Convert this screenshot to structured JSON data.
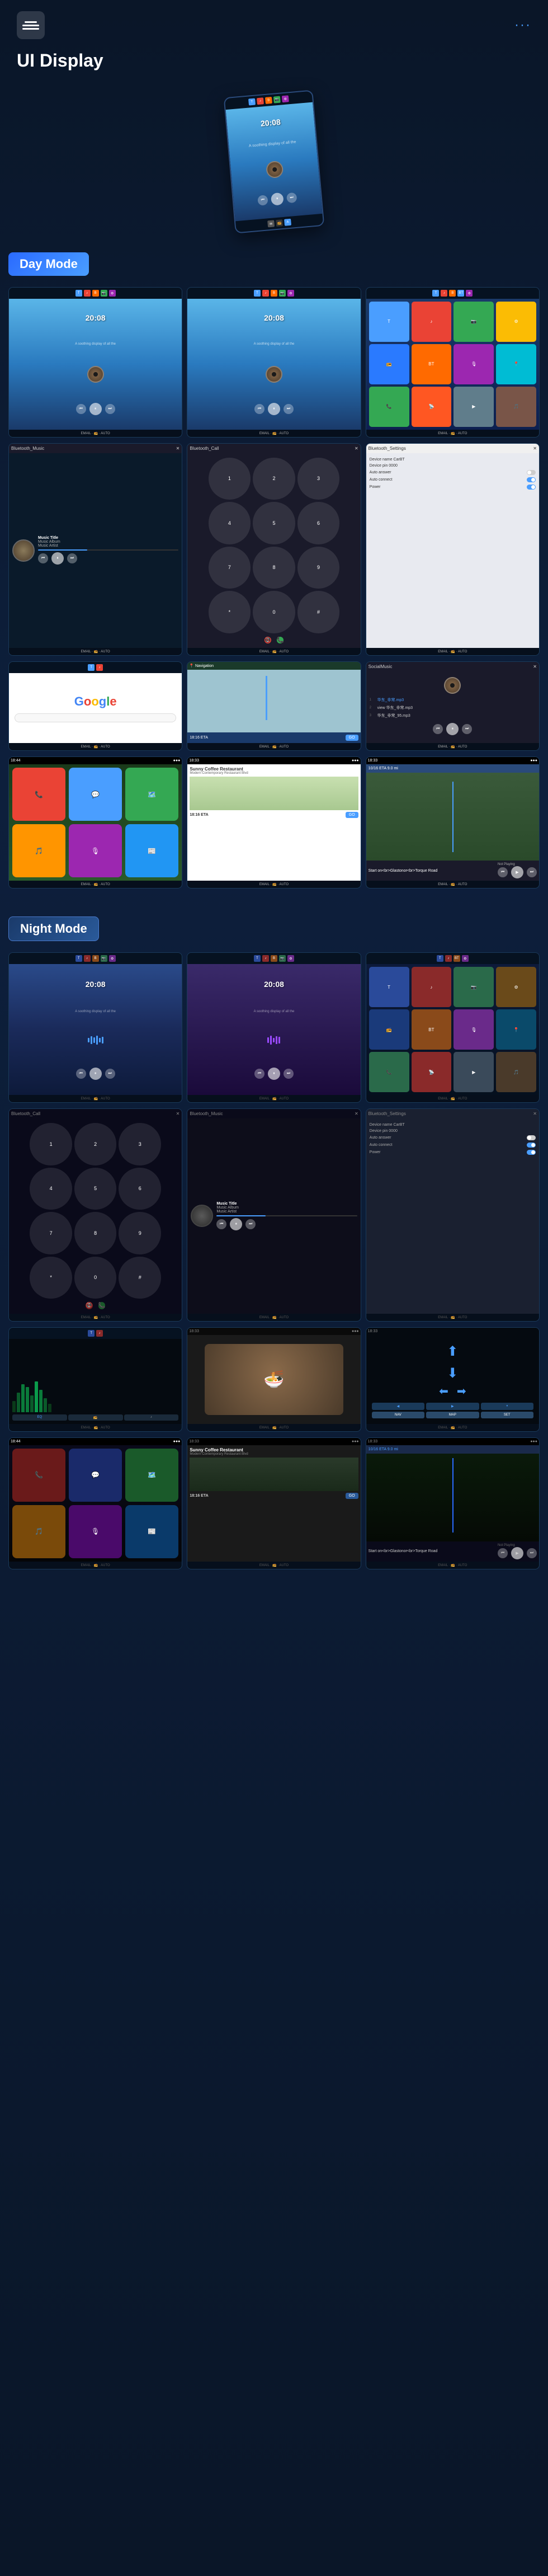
{
  "header": {
    "title": "UI Display",
    "menu_icon": "☰",
    "dots_icon": "···"
  },
  "hero": {
    "device_time": "20:08",
    "device_subtitle": "A soothing display of all the"
  },
  "modes": {
    "day_label": "Day Mode",
    "night_label": "Night Mode"
  },
  "screens": {
    "time": "20:08",
    "music_title": "Music Title",
    "music_album": "Music Album",
    "music_artist": "Music Artist",
    "bluetooth_music": "Bluetooth_Music",
    "bluetooth_call": "Bluetooth_Call",
    "bluetooth_settings": "Bluetooth_Settings",
    "device_name": "Device name  CarBT",
    "device_pin": "Device pin    0000",
    "auto_answer": "Auto answer",
    "auto_connect": "Auto connect",
    "power": "Power",
    "google_text": "Google",
    "restaurant_name": "Sunny Coffee Restaurant",
    "restaurant_addr": "Modern Contemporary<br>Restaurant Blvd",
    "nav_eta": "18:16 ETA",
    "nav_dist": "10/16 ETA   9.0 mi",
    "nav_start": "Start on<br>Glastonor<br>Torque Road",
    "not_playing": "Not Playing",
    "go_label": "GO",
    "social_title": "SocialMusic"
  },
  "colors": {
    "accent": "#4a9eff",
    "day_badge": "#2a6aff",
    "night_badge": "#1a3a6a",
    "bg_dark": "#0a1628",
    "screen_day_top": "#5ab5e8",
    "screen_night_top": "#1a3a6a"
  },
  "app_icons": [
    {
      "color": "#4a9eff",
      "label": "TG"
    },
    {
      "color": "#ea4335",
      "label": "♪"
    },
    {
      "color": "#34a853",
      "label": "📷"
    },
    {
      "color": "#fbbc04",
      "label": "⚙"
    },
    {
      "color": "#4a9eff",
      "label": "📻"
    },
    {
      "color": "#ea4335",
      "label": "🎵"
    },
    {
      "color": "#ff6a00",
      "label": "BT"
    },
    {
      "color": "#2a7aff",
      "label": "▶"
    },
    {
      "color": "#34a853",
      "label": "📞"
    },
    {
      "color": "#9c27b0",
      "label": "🎙"
    },
    {
      "color": "#00bcd4",
      "label": "📍"
    },
    {
      "color": "#ff5722",
      "label": "📡"
    }
  ]
}
